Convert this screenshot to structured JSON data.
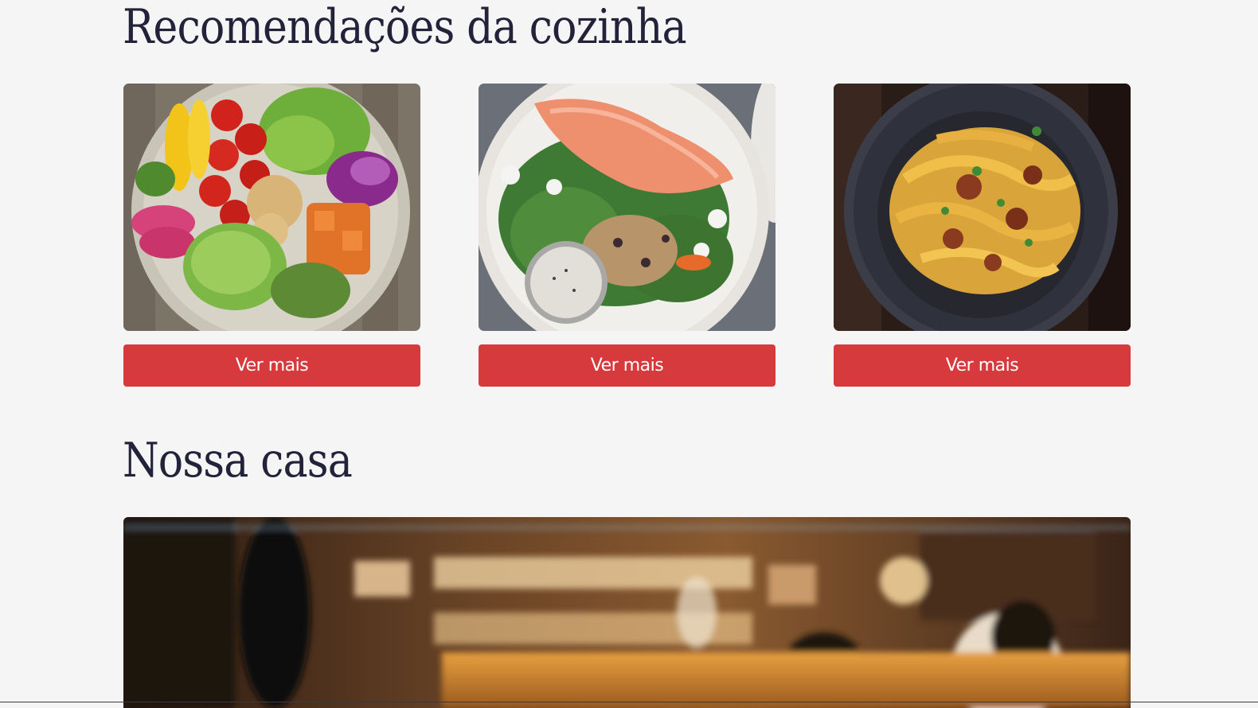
{
  "recommendations": {
    "title": "Recomendações da cozinha",
    "cards": [
      {
        "image": "vegetable-bowl-photo",
        "button_label": "Ver mais"
      },
      {
        "image": "salmon-salad-photo",
        "button_label": "Ver mais"
      },
      {
        "image": "pasta-bowl-photo",
        "button_label": "Ver mais"
      }
    ]
  },
  "house": {
    "title": "Nossa casa",
    "image": "restaurant-interior-photo"
  },
  "colors": {
    "background": "#f5f5f5",
    "title_text": "#22223a",
    "button_bg": "#d63a3d",
    "button_text": "#ffffff"
  }
}
